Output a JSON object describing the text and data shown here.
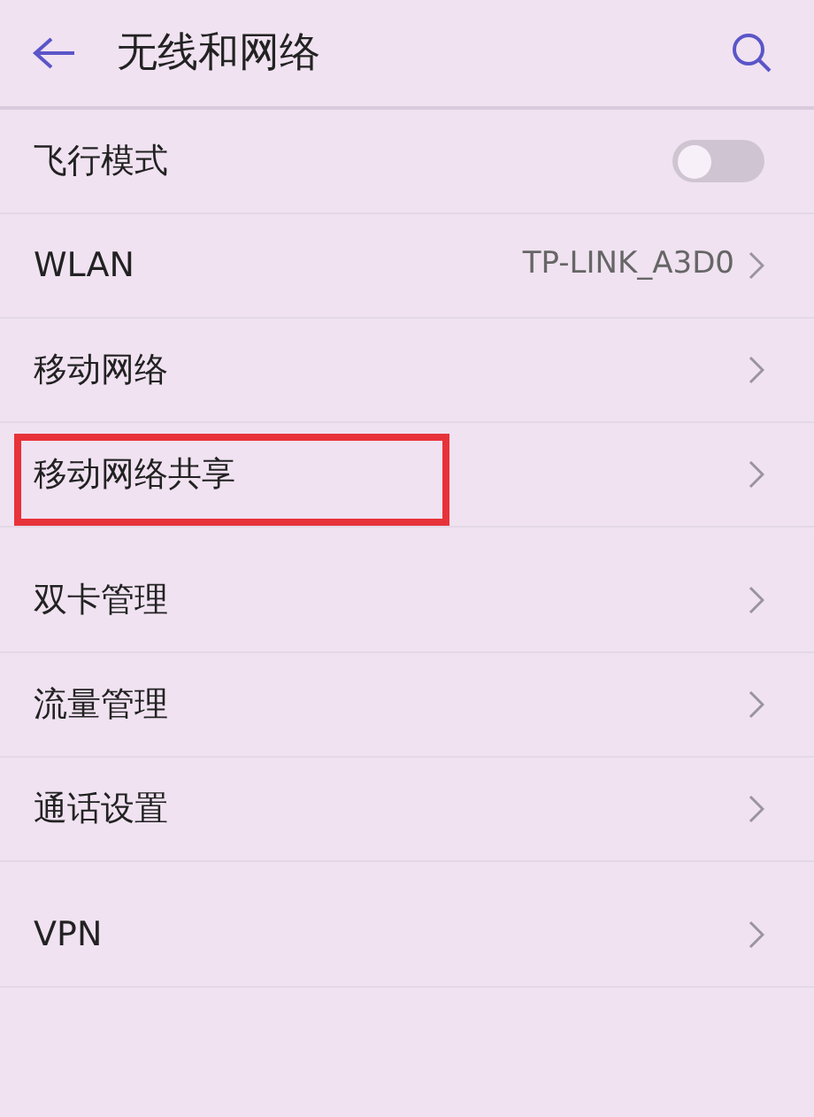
{
  "header": {
    "title": "无线和网络"
  },
  "sections": [
    {
      "items": [
        {
          "kind": "toggle",
          "label": "飞行模式",
          "on": false,
          "highlighted": false
        },
        {
          "kind": "value",
          "label": "WLAN",
          "value": "TP-LINK_A3D0",
          "highlighted": false
        },
        {
          "kind": "link",
          "label": "移动网络",
          "highlighted": false
        },
        {
          "kind": "link",
          "label": "移动网络共享",
          "highlighted": true
        }
      ]
    },
    {
      "items": [
        {
          "kind": "link",
          "label": "双卡管理",
          "highlighted": false
        },
        {
          "kind": "link",
          "label": "流量管理",
          "highlighted": false
        },
        {
          "kind": "link",
          "label": "通话设置",
          "highlighted": false
        }
      ]
    },
    {
      "items": [
        {
          "kind": "link",
          "label": "VPN",
          "highlighted": false
        }
      ]
    }
  ]
}
